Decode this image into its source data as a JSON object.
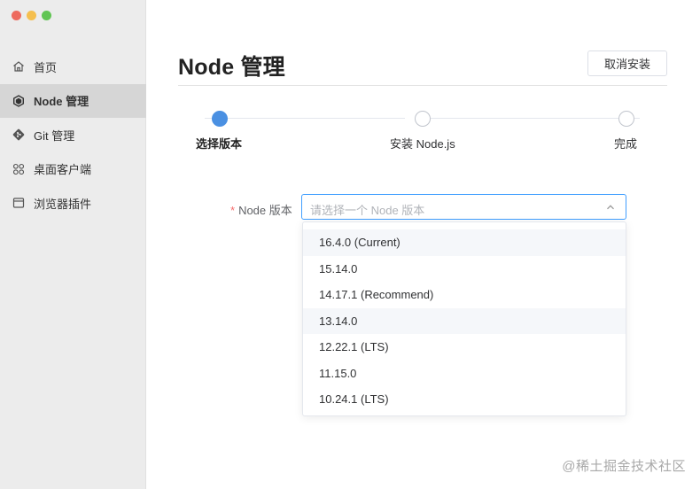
{
  "window": {
    "traffic_lights": [
      "close",
      "minimize",
      "zoom"
    ]
  },
  "sidebar": {
    "items": [
      {
        "label": "首页",
        "icon": "home-icon",
        "active": false
      },
      {
        "label": "Node 管理",
        "icon": "node-hexagon-icon",
        "active": true
      },
      {
        "label": "Git 管理",
        "icon": "git-icon",
        "active": false
      },
      {
        "label": "桌面客户端",
        "icon": "grid-apps-icon",
        "active": false
      },
      {
        "label": "浏览器插件",
        "icon": "browser-window-icon",
        "active": false
      }
    ]
  },
  "header": {
    "title": "Node 管理",
    "cancel_label": "取消安装"
  },
  "steps": [
    {
      "label": "选择版本",
      "state": "active"
    },
    {
      "label": "安装 Node.js",
      "state": "pending"
    },
    {
      "label": "完成",
      "state": "pending"
    }
  ],
  "form": {
    "required_mark": "*",
    "version_label": "Node 版本",
    "placeholder": "请选择一个 Node 版本",
    "options": [
      "16.4.0 (Current)",
      "15.14.0",
      "14.17.1 (Recommend)",
      "13.14.0",
      "12.22.1 (LTS)",
      "11.15.0",
      "10.24.1 (LTS)"
    ],
    "highlighted_options": [
      0,
      3
    ]
  },
  "watermark": "@稀土掘金技术社区",
  "colors": {
    "accent": "#4a90e2",
    "focus_border": "#409eff",
    "required": "#f56c6c",
    "sidebar_bg": "#ececec",
    "sidebar_active": "#d6d6d6"
  }
}
